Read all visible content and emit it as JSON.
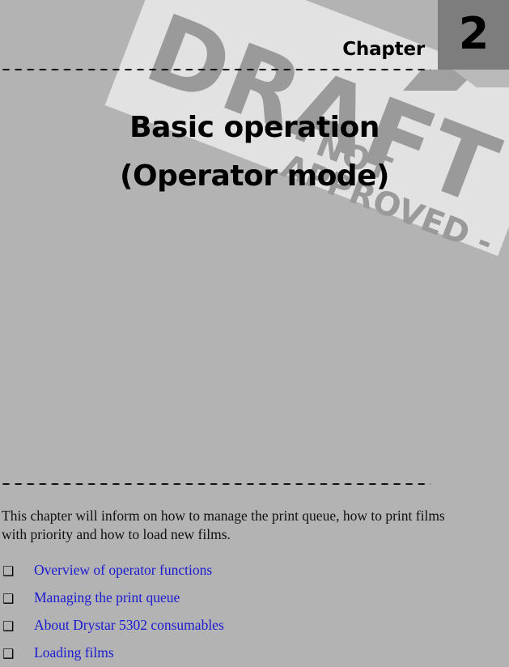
{
  "header": {
    "chapter_word": "Chapter",
    "chapter_number": "2"
  },
  "title": {
    "line1": "Basic operation",
    "line2": "(Operator mode)"
  },
  "watermark": {
    "main": "DRAFT",
    "sub": "- NOT APPROVED -"
  },
  "intro": {
    "text": "This chapter will inform on how to manage the print queue, how to print films with priority and how to load new films."
  },
  "toc": {
    "bullet_glyph": "❑",
    "items": [
      {
        "label": "Overview of operator functions"
      },
      {
        "label": "Managing the print queue"
      },
      {
        "label": "About Drystar 5302 consumables"
      },
      {
        "label": "Loading films"
      }
    ]
  },
  "colors": {
    "page_background": "#b3b3b3",
    "chapter_box": "#7d7d7d",
    "watermark_band": "#e2e2e2",
    "watermark_text": "#9a9a9a",
    "link": "#1a1ad0",
    "body_text": "#111111"
  }
}
